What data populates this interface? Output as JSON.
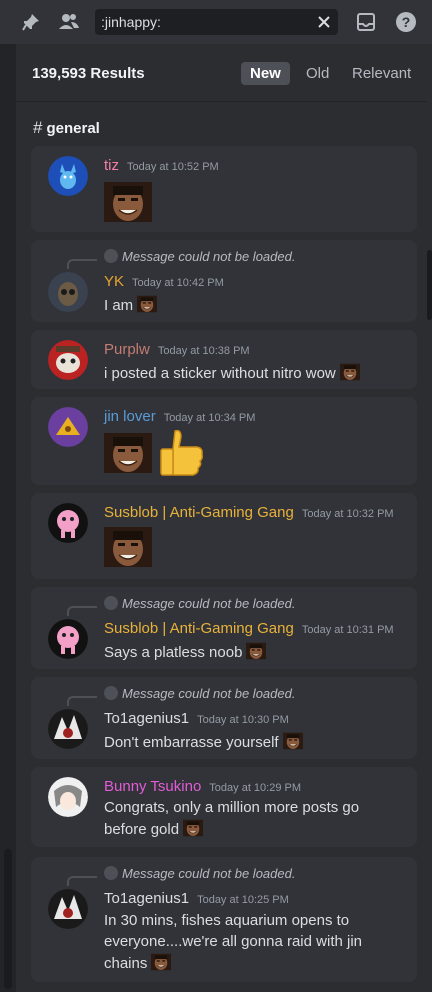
{
  "search": {
    "value": ":jinhappy:",
    "placeholder": ""
  },
  "header": {
    "result_count": "139,593 Results",
    "tabs": [
      "New",
      "Old",
      "Relevant"
    ],
    "active_tab": "New"
  },
  "channel": {
    "name": "general"
  },
  "reply_text": "Message could not be loaded.",
  "messages": [
    {
      "author": "tiz",
      "time": "Today at 10:52 PM",
      "text": ""
    },
    {
      "author": "YK",
      "time": "Today at 10:42 PM",
      "text": "I am"
    },
    {
      "author": "Purplw",
      "time": "Today at 10:38 PM",
      "text": "i posted a sticker without nitro wow"
    },
    {
      "author": "jin lover",
      "time": "Today at 10:34 PM",
      "text": ""
    },
    {
      "author": "Susblob | Anti-Gaming Gang",
      "time": "Today at 10:32 PM",
      "text": ""
    },
    {
      "author": "Susblob | Anti-Gaming Gang",
      "time": "Today at 10:31 PM",
      "text": "Says a platless noob"
    },
    {
      "author": "To1agenius1",
      "time": "Today at 10:30 PM",
      "text": "Don't embarrasse yourself"
    },
    {
      "author": "Bunny Tsukino",
      "time": "Today at 10:29 PM",
      "text": "Congrats, only a million more posts go before gold"
    },
    {
      "author": "To1agenius1",
      "time": "Today at 10:25 PM",
      "text": "In 30 mins, fishes aquarium opens to everyone....we're all gonna raid with jin chains"
    }
  ],
  "colors": {
    "tiz": "#f47fa4",
    "yk": "#e7a530",
    "purplw": "#c27c72",
    "jin_lover": "#5a9bd5",
    "susblob": "#e8b23a",
    "to1": "#dbdee1",
    "bunny": "#e05cd6"
  },
  "icons": [
    "pin-icon",
    "members-icon",
    "clear-icon",
    "inbox-icon",
    "help-icon",
    "reply-arrow-icon",
    "jinhappy-emoji",
    "thumbs-up-emoji"
  ]
}
